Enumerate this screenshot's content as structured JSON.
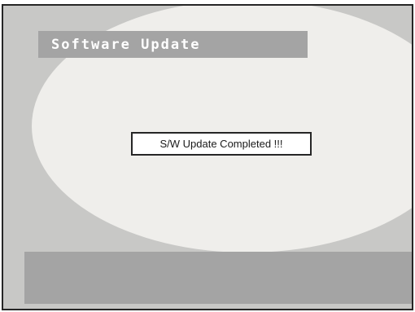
{
  "screen": {
    "title": "Software Update",
    "message": "S/W Update Completed !!!"
  },
  "colors": {
    "frame": "#262626",
    "background": "#c8c8c6",
    "highlight": "#efeeeb",
    "bar": "#a4a4a4",
    "title_text": "#ffffff"
  }
}
